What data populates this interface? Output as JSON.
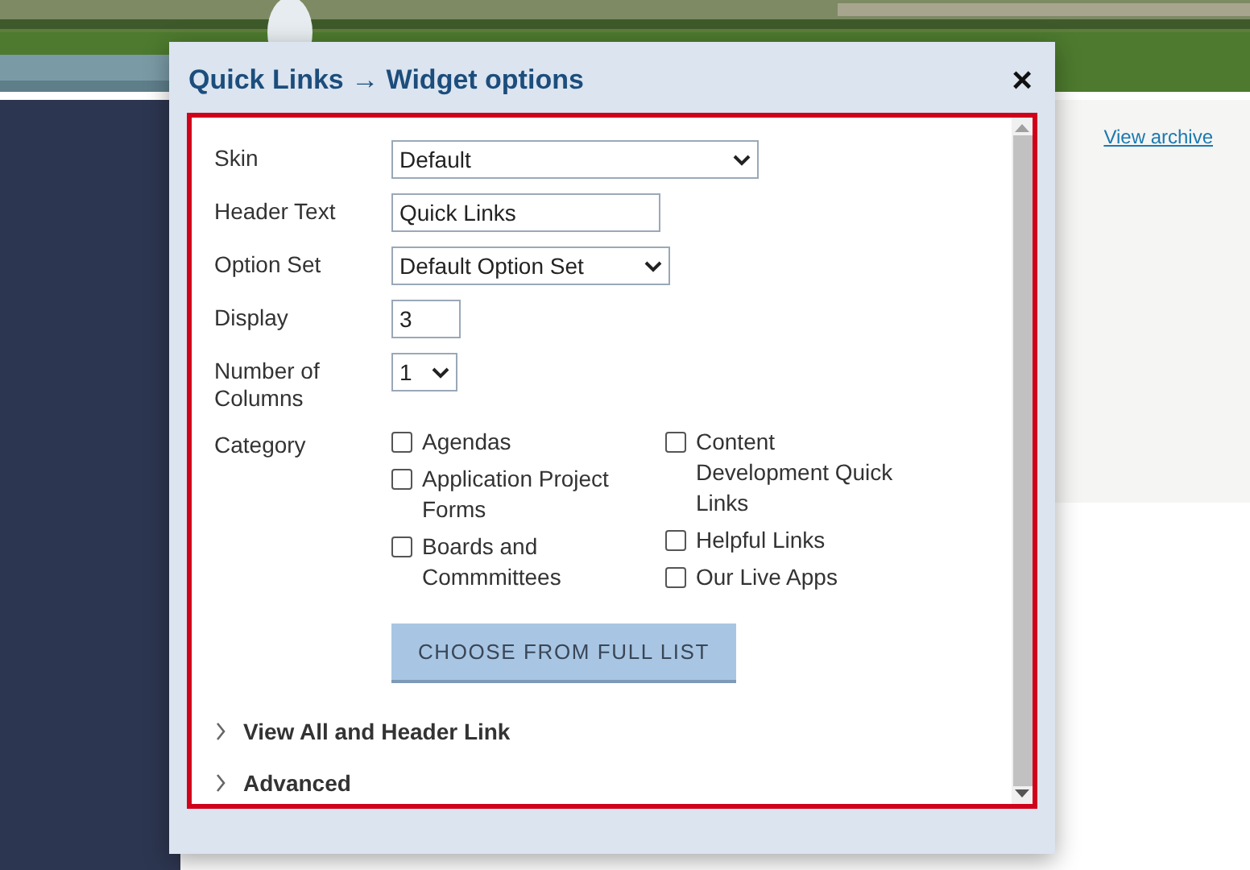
{
  "page": {
    "archive_link": "View archive"
  },
  "dialog": {
    "title": "Quick Links → Widget options",
    "close": "×",
    "fields": [
      {
        "kind": "select",
        "label": "Skin",
        "value": "Default"
      },
      {
        "kind": "text",
        "label": "Header Text",
        "value": "Quick Links"
      },
      {
        "kind": "select",
        "label": "Option Set",
        "value": "Default Option Set"
      },
      {
        "kind": "text",
        "label": "Display",
        "value": "3"
      },
      {
        "kind": "select",
        "label": "Number of Columns",
        "value": "1"
      }
    ],
    "category": {
      "label": "Category",
      "columns": [
        [
          {
            "label": "Agendas",
            "checked": false
          },
          {
            "label": "Application Project Forms",
            "checked": false
          },
          {
            "label": "Boards and Commmittees",
            "checked": false
          }
        ],
        [
          {
            "label": "Content Development Quick Links",
            "checked": false
          },
          {
            "label": "Helpful Links",
            "checked": false
          },
          {
            "label": "Our Live Apps",
            "checked": false
          }
        ]
      ]
    },
    "button": "CHOOSE FROM FULL LIST",
    "sections": [
      {
        "label": "View All and Header Link",
        "expanded": false
      },
      {
        "label": "Advanced",
        "expanded": false
      }
    ]
  }
}
